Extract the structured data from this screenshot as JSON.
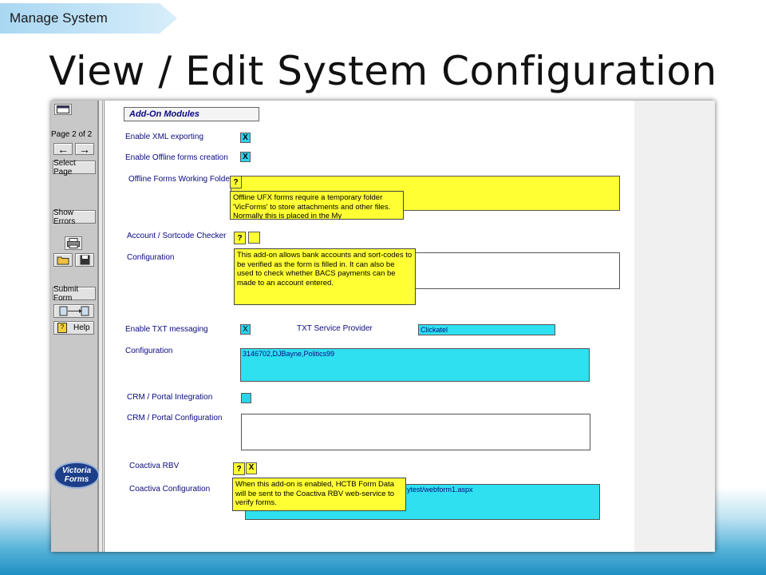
{
  "header": {
    "breadcrumb": "Manage System",
    "title": "View / Edit System Configuration"
  },
  "toolbar": {
    "page_indicator": "Page 2 of 2",
    "select_page": "Select Page",
    "show_errors": "Show Errors",
    "submit_form": "Submit Form",
    "help": "Help",
    "logo_line1": "Victoria",
    "logo_line2": "Forms"
  },
  "form": {
    "section_title": "Add-On Modules",
    "xml_export_label": "Enable XML exporting",
    "xml_export_value": "X",
    "offline_forms_label": "Enable Offline forms creation",
    "offline_forms_value": "X",
    "offline_folder_label": "Offline Forms Working Folde",
    "offline_folder_tip": "Offline UFX forms require a temporary folder 'VicForms' to store attachments and other files. Normally this is placed in the My",
    "account_checker_label": "Account / Sortcode Checker",
    "account_config_label": "Configuration",
    "account_tip": "This add-on allows bank accounts and sort-codes to be verified as the form is filled in. It can also be used to check whether BACS payments can be made to an account entered.",
    "txt_label": "Enable TXT messaging",
    "txt_value": "X",
    "txt_provider_label": "TXT Service Provider",
    "txt_provider_value": "Clickatel",
    "txt_config_label": "Configuration",
    "txt_config_value": "3146702,DJBayne,Politics99",
    "crm_label": "CRM / Portal Integration",
    "crm_config_label": "CRM / Portal Configuration",
    "coactiva_label": "Coactiva RBV",
    "coactiva_value": "X",
    "coactiva_config_label": "Coactiva Configuration",
    "coactiva_config_value": "ytest/webform1.aspx",
    "coactiva_tip": "When this add-on is enabled, HCTB Form Data will be sent to the Coactiva RBV web-service to verify forms.",
    "help_q": "?"
  }
}
